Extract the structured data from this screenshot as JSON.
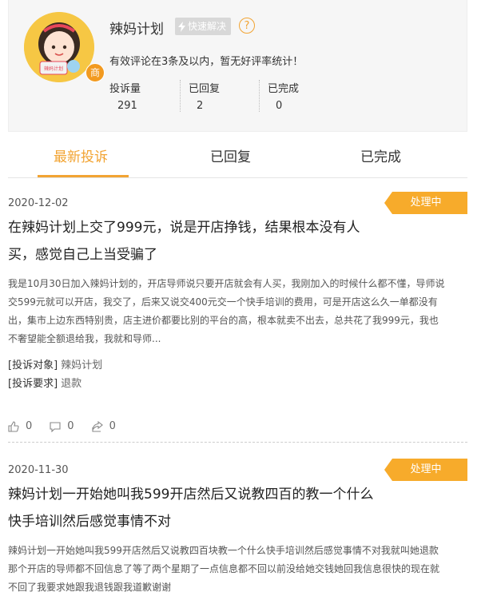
{
  "profile": {
    "name": "辣妈计划",
    "quick_badge": "快速解决",
    "help_symbol": "?",
    "avatar_badge": "商",
    "avatar_sign": "辣妈计划",
    "eval_note": "有效评论在3条及以内，暂无好评率统计！",
    "stats": [
      {
        "label": "投诉量",
        "value": "291"
      },
      {
        "label": "已回复",
        "value": "2"
      },
      {
        "label": "已完成",
        "value": "0"
      }
    ]
  },
  "tabs": [
    "最新投诉",
    "已回复",
    "已完成"
  ],
  "complaints": [
    {
      "date": "2020-12-02",
      "status": "处理中",
      "title_line1": "在辣妈计划上交了999元，说是开店挣钱，结果根本没有人",
      "title_line2": "买，感觉自己上当受骗了",
      "body": [
        "我是10月30日加入辣妈计划的，开店导师说只要开店就会有人买，我刚加入的时候什么都不懂，导师说",
        "交599元就可以开店，我交了，后来又说交400元交一个快手培训的费用，可是开店这么久一单都没有",
        "出，集市上边东西特别贵，店主进价都要比别的平台的高，根本就卖不出去，总共花了我999元，我也",
        "不奢望能全额退给我，我就和导师..."
      ],
      "target_label": "[投诉对象]",
      "target_value": "辣妈计划",
      "request_label": "[投诉要求]",
      "request_value": "退款",
      "likes": "0",
      "comments": "0",
      "shares": "0"
    },
    {
      "date": "2020-11-30",
      "status": "处理中",
      "title_line1": "辣妈计划一开始她叫我599开店然后又说教四百的教一个什么",
      "title_line2": "快手培训然后感觉事情不对",
      "body": [
        "辣妈计划一开始她叫我599开店然后又说教四百块教一个什么快手培训然后感觉事情不对我就叫她退款",
        "那个开店的导师都不回信息了等了两个星期了一点信息都不回以前没给她交钱她回我信息很快的现在就",
        "不回了我要求她跟我退钱跟我道歉谢谢"
      ]
    }
  ],
  "colors": {
    "accent": "#f2a433",
    "tag": "#f7ab2b"
  }
}
